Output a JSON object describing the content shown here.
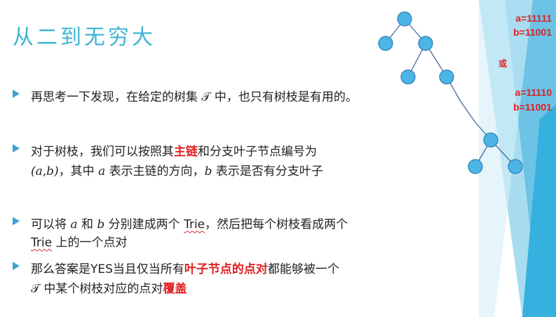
{
  "title": "从二到无穷大",
  "side": {
    "a1": "a=11111",
    "b1": "b=11001",
    "or": "或",
    "a2": "a=11110",
    "b2": "b=11001"
  },
  "bullets": [
    {
      "text": "再思考一下发现，在给定的树集 𝒯 中，也只有树枝是有用的。"
    },
    {
      "l1_pre": "对于树枝，我们可以按照其",
      "l1_red": "主链",
      "l1_post": "和分支叶子节点编号为",
      "l2_a": "(a,b)",
      "l2_mid1": "，其中 ",
      "l2_var_a": "a",
      "l2_mid2": " 表示主链的方向，",
      "l2_var_b": "b",
      "l2_post": " 表示是否有分支叶子"
    },
    {
      "l1_pre": "可以将 ",
      "l1_a": "a",
      "l1_mid": " 和 ",
      "l1_b": "b",
      "l1_mid2": " 分别建成两个 ",
      "l1_trie": "Trie",
      "l1_post": "，然后把每个树枝看成两个",
      "l2_trie": "Trie",
      "l2_post": " 上的一个点对"
    },
    {
      "l1_pre": "那么答案是YES当且仅当所有",
      "l1_red": "叶子节点的点对",
      "l1_post": "都能够被一个",
      "l2_pre": "𝒯 中某个树枝对应的点对",
      "l2_red": "覆盖"
    }
  ]
}
